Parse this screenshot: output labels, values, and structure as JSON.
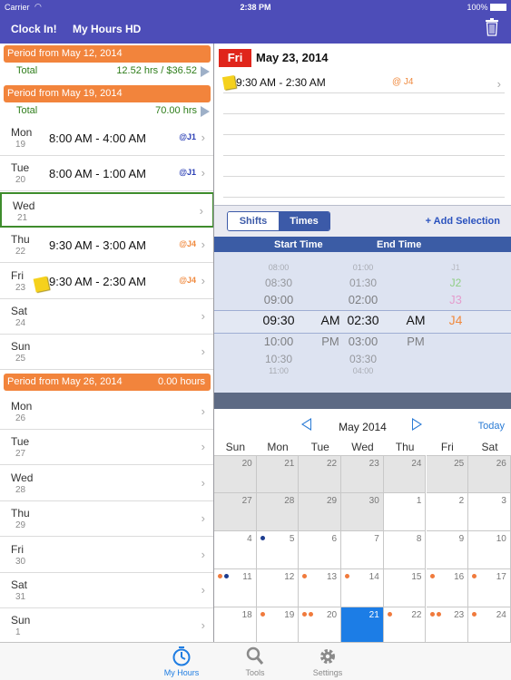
{
  "status": {
    "carrier": "Carrier",
    "time": "2:38 PM",
    "battery": "100%"
  },
  "nav": {
    "clock_in": "Clock In!",
    "title": "My Hours HD"
  },
  "periods": [
    {
      "label": "Period from May 12, 2014",
      "hours": "",
      "total_label": "Total",
      "total_value": "12.52 hrs / $36.52"
    },
    {
      "label": "Period from May 19, 2014",
      "hours": "",
      "total_label": "Total",
      "total_value": "70.00 hrs"
    },
    {
      "label": "Period from May 26, 2014",
      "hours": "0.00 hours"
    }
  ],
  "week19": [
    {
      "day": "Mon",
      "num": "19",
      "time": "8:00 AM - 4:00 AM",
      "tag": "@J1",
      "tag_color": "#2b3fb5"
    },
    {
      "day": "Tue",
      "num": "20",
      "time": "8:00 AM - 1:00 AM",
      "tag": "@J1",
      "tag_color": "#2b3fb5"
    },
    {
      "day": "Wed",
      "num": "21",
      "time": "",
      "tag": ""
    },
    {
      "day": "Thu",
      "num": "22",
      "time": "9:30 AM - 3:00 AM",
      "tag": "@J4",
      "tag_color": "#f08a3f"
    },
    {
      "day": "Fri",
      "num": "23",
      "time": "9:30 AM - 2:30 AM",
      "tag": "@J4",
      "tag_color": "#f08a3f"
    },
    {
      "day": "Sat",
      "num": "24",
      "time": "",
      "tag": ""
    },
    {
      "day": "Sun",
      "num": "25",
      "time": "",
      "tag": ""
    }
  ],
  "week26": [
    {
      "day": "Mon",
      "num": "26"
    },
    {
      "day": "Tue",
      "num": "27"
    },
    {
      "day": "Wed",
      "num": "28"
    },
    {
      "day": "Thu",
      "num": "29"
    },
    {
      "day": "Fri",
      "num": "30"
    },
    {
      "day": "Sat",
      "num": "31"
    },
    {
      "day": "Sun",
      "num": "1"
    }
  ],
  "detail": {
    "day_badge": "Fri",
    "date": "May 23, 2014",
    "shift_time": "9:30 AM - 2:30 AM",
    "shift_tag": "@ J4"
  },
  "segmented": {
    "shifts": "Shifts",
    "times": "Times",
    "add_selection": "+ Add Selection"
  },
  "picker": {
    "start_header": "Start Time",
    "end_header": "End Time",
    "rows": [
      {
        "start": "08:00",
        "ampm1": "",
        "end": "01:00",
        "ampm2": "",
        "job": "J1",
        "job_color": "#888"
      },
      {
        "start": "08:30",
        "ampm1": "",
        "end": "01:30",
        "ampm2": "",
        "job": "J2",
        "job_color": "#5cbf3b"
      },
      {
        "start": "09:00",
        "ampm1": "",
        "end": "02:00",
        "ampm2": "",
        "job": "J3",
        "job_color": "#e68bc4"
      },
      {
        "start": "09:30",
        "ampm1": "AM",
        "end": "02:30",
        "ampm2": "AM",
        "job": "J4",
        "job_color": "#f08a3f"
      },
      {
        "start": "10:00",
        "ampm1": "PM",
        "end": "03:00",
        "ampm2": "PM",
        "job": "",
        "job_color": "#888"
      },
      {
        "start": "10:30",
        "ampm1": "",
        "end": "03:30",
        "ampm2": "",
        "job": "",
        "job_color": "#888"
      },
      {
        "start": "11:00",
        "ampm1": "",
        "end": "04:00",
        "ampm2": "",
        "job": "",
        "job_color": "#888"
      }
    ]
  },
  "calendar": {
    "month": "May 2014",
    "today_label": "Today",
    "weekdays": [
      "Sun",
      "Mon",
      "Tue",
      "Wed",
      "Thu",
      "Fri",
      "Sat"
    ],
    "weeks": [
      [
        {
          "n": "20",
          "dim": true,
          "dots": []
        },
        {
          "n": "21",
          "dim": true,
          "dots": []
        },
        {
          "n": "22",
          "dim": true,
          "dots": []
        },
        {
          "n": "23",
          "dim": true,
          "dots": []
        },
        {
          "n": "24",
          "dim": true,
          "dots": []
        },
        {
          "n": "25",
          "dim": true,
          "dots": []
        },
        {
          "n": "26",
          "dim": true,
          "dots": []
        }
      ],
      [
        {
          "n": "27",
          "dim": true,
          "dots": []
        },
        {
          "n": "28",
          "dim": true,
          "dots": []
        },
        {
          "n": "29",
          "dim": true,
          "dots": []
        },
        {
          "n": "30",
          "dim": true,
          "dots": []
        },
        {
          "n": "1",
          "dim": false,
          "dots": []
        },
        {
          "n": "2",
          "dim": false,
          "dots": []
        },
        {
          "n": "3",
          "dim": false,
          "dots": []
        }
      ],
      [
        {
          "n": "4",
          "dim": false,
          "dots": []
        },
        {
          "n": "5",
          "dim": false,
          "dots": [
            "#1d3d8f"
          ]
        },
        {
          "n": "6",
          "dim": false,
          "dots": []
        },
        {
          "n": "7",
          "dim": false,
          "dots": []
        },
        {
          "n": "8",
          "dim": false,
          "dots": []
        },
        {
          "n": "9",
          "dim": false,
          "dots": []
        },
        {
          "n": "10",
          "dim": false,
          "dots": []
        }
      ],
      [
        {
          "n": "11",
          "dim": false,
          "dots": [
            "#f07a3c",
            "#1d3d8f"
          ]
        },
        {
          "n": "12",
          "dim": false,
          "dots": []
        },
        {
          "n": "13",
          "dim": false,
          "dots": [
            "#f07a3c"
          ]
        },
        {
          "n": "14",
          "dim": false,
          "dots": [
            "#f07a3c"
          ]
        },
        {
          "n": "15",
          "dim": false,
          "dots": []
        },
        {
          "n": "16",
          "dim": false,
          "dots": [
            "#f07a3c"
          ]
        },
        {
          "n": "17",
          "dim": false,
          "dots": [
            "#f07a3c"
          ]
        }
      ],
      [
        {
          "n": "18",
          "dim": false,
          "dots": []
        },
        {
          "n": "19",
          "dim": false,
          "dots": [
            "#f07a3c"
          ]
        },
        {
          "n": "20",
          "dim": false,
          "dots": [
            "#f07a3c",
            "#f07a3c"
          ]
        },
        {
          "n": "21",
          "dim": false,
          "today": true,
          "dots": []
        },
        {
          "n": "22",
          "dim": false,
          "dots": [
            "#f07a3c"
          ]
        },
        {
          "n": "23",
          "dim": false,
          "dots": [
            "#f07a3c",
            "#f07a3c"
          ]
        },
        {
          "n": "24",
          "dim": false,
          "dots": [
            "#f07a3c"
          ]
        }
      ]
    ]
  },
  "tabs": [
    {
      "label": "My Hours",
      "icon": "clock-icon",
      "active": true
    },
    {
      "label": "Tools",
      "icon": "magnifier-icon",
      "active": false
    },
    {
      "label": "Settings",
      "icon": "gear-icon",
      "active": false
    }
  ],
  "colors": {
    "nav": "#4d4db8",
    "period": "#f2843c",
    "accent": "#1c7de6",
    "selected_border": "#3e8c2c"
  }
}
